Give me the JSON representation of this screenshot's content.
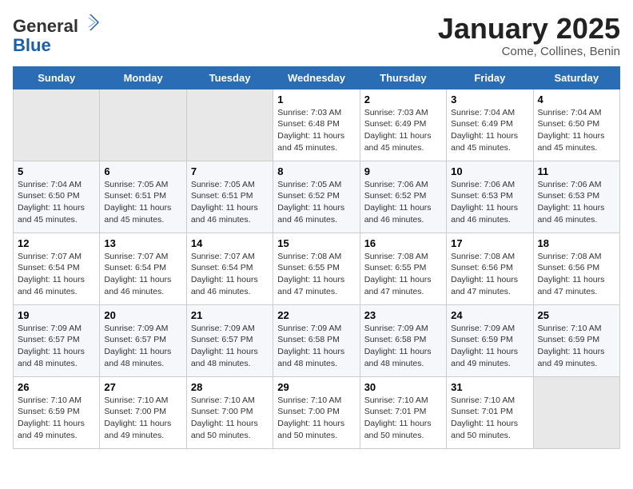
{
  "header": {
    "logo_general": "General",
    "logo_blue": "Blue",
    "month_title": "January 2025",
    "location": "Come, Collines, Benin"
  },
  "days_of_week": [
    "Sunday",
    "Monday",
    "Tuesday",
    "Wednesday",
    "Thursday",
    "Friday",
    "Saturday"
  ],
  "weeks": [
    [
      {
        "day": "",
        "info": ""
      },
      {
        "day": "",
        "info": ""
      },
      {
        "day": "",
        "info": ""
      },
      {
        "day": "1",
        "info": "Sunrise: 7:03 AM\nSunset: 6:48 PM\nDaylight: 11 hours and 45 minutes."
      },
      {
        "day": "2",
        "info": "Sunrise: 7:03 AM\nSunset: 6:49 PM\nDaylight: 11 hours and 45 minutes."
      },
      {
        "day": "3",
        "info": "Sunrise: 7:04 AM\nSunset: 6:49 PM\nDaylight: 11 hours and 45 minutes."
      },
      {
        "day": "4",
        "info": "Sunrise: 7:04 AM\nSunset: 6:50 PM\nDaylight: 11 hours and 45 minutes."
      }
    ],
    [
      {
        "day": "5",
        "info": "Sunrise: 7:04 AM\nSunset: 6:50 PM\nDaylight: 11 hours and 45 minutes."
      },
      {
        "day": "6",
        "info": "Sunrise: 7:05 AM\nSunset: 6:51 PM\nDaylight: 11 hours and 45 minutes."
      },
      {
        "day": "7",
        "info": "Sunrise: 7:05 AM\nSunset: 6:51 PM\nDaylight: 11 hours and 46 minutes."
      },
      {
        "day": "8",
        "info": "Sunrise: 7:05 AM\nSunset: 6:52 PM\nDaylight: 11 hours and 46 minutes."
      },
      {
        "day": "9",
        "info": "Sunrise: 7:06 AM\nSunset: 6:52 PM\nDaylight: 11 hours and 46 minutes."
      },
      {
        "day": "10",
        "info": "Sunrise: 7:06 AM\nSunset: 6:53 PM\nDaylight: 11 hours and 46 minutes."
      },
      {
        "day": "11",
        "info": "Sunrise: 7:06 AM\nSunset: 6:53 PM\nDaylight: 11 hours and 46 minutes."
      }
    ],
    [
      {
        "day": "12",
        "info": "Sunrise: 7:07 AM\nSunset: 6:54 PM\nDaylight: 11 hours and 46 minutes."
      },
      {
        "day": "13",
        "info": "Sunrise: 7:07 AM\nSunset: 6:54 PM\nDaylight: 11 hours and 46 minutes."
      },
      {
        "day": "14",
        "info": "Sunrise: 7:07 AM\nSunset: 6:54 PM\nDaylight: 11 hours and 46 minutes."
      },
      {
        "day": "15",
        "info": "Sunrise: 7:08 AM\nSunset: 6:55 PM\nDaylight: 11 hours and 47 minutes."
      },
      {
        "day": "16",
        "info": "Sunrise: 7:08 AM\nSunset: 6:55 PM\nDaylight: 11 hours and 47 minutes."
      },
      {
        "day": "17",
        "info": "Sunrise: 7:08 AM\nSunset: 6:56 PM\nDaylight: 11 hours and 47 minutes."
      },
      {
        "day": "18",
        "info": "Sunrise: 7:08 AM\nSunset: 6:56 PM\nDaylight: 11 hours and 47 minutes."
      }
    ],
    [
      {
        "day": "19",
        "info": "Sunrise: 7:09 AM\nSunset: 6:57 PM\nDaylight: 11 hours and 48 minutes."
      },
      {
        "day": "20",
        "info": "Sunrise: 7:09 AM\nSunset: 6:57 PM\nDaylight: 11 hours and 48 minutes."
      },
      {
        "day": "21",
        "info": "Sunrise: 7:09 AM\nSunset: 6:57 PM\nDaylight: 11 hours and 48 minutes."
      },
      {
        "day": "22",
        "info": "Sunrise: 7:09 AM\nSunset: 6:58 PM\nDaylight: 11 hours and 48 minutes."
      },
      {
        "day": "23",
        "info": "Sunrise: 7:09 AM\nSunset: 6:58 PM\nDaylight: 11 hours and 48 minutes."
      },
      {
        "day": "24",
        "info": "Sunrise: 7:09 AM\nSunset: 6:59 PM\nDaylight: 11 hours and 49 minutes."
      },
      {
        "day": "25",
        "info": "Sunrise: 7:10 AM\nSunset: 6:59 PM\nDaylight: 11 hours and 49 minutes."
      }
    ],
    [
      {
        "day": "26",
        "info": "Sunrise: 7:10 AM\nSunset: 6:59 PM\nDaylight: 11 hours and 49 minutes."
      },
      {
        "day": "27",
        "info": "Sunrise: 7:10 AM\nSunset: 7:00 PM\nDaylight: 11 hours and 49 minutes."
      },
      {
        "day": "28",
        "info": "Sunrise: 7:10 AM\nSunset: 7:00 PM\nDaylight: 11 hours and 50 minutes."
      },
      {
        "day": "29",
        "info": "Sunrise: 7:10 AM\nSunset: 7:00 PM\nDaylight: 11 hours and 50 minutes."
      },
      {
        "day": "30",
        "info": "Sunrise: 7:10 AM\nSunset: 7:01 PM\nDaylight: 11 hours and 50 minutes."
      },
      {
        "day": "31",
        "info": "Sunrise: 7:10 AM\nSunset: 7:01 PM\nDaylight: 11 hours and 50 minutes."
      },
      {
        "day": "",
        "info": ""
      }
    ]
  ]
}
